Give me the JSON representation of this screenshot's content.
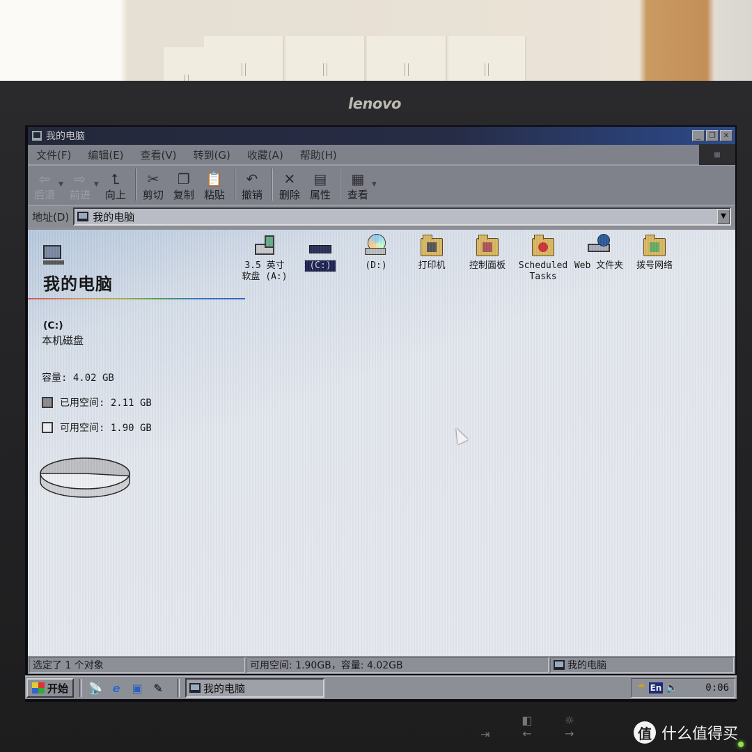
{
  "monitor": {
    "brand": "lenovo",
    "buttons": [
      "input-icon",
      "left-arrow-icon",
      "right-arrow-icon"
    ],
    "watermark": "什么值得买",
    "watermark_badge": "值"
  },
  "window": {
    "title": "我的电脑",
    "controls": {
      "minimize": "_",
      "restore": "❐",
      "close": "✕"
    }
  },
  "menu": [
    {
      "label": "文件(F)"
    },
    {
      "label": "编辑(E)"
    },
    {
      "label": "查看(V)"
    },
    {
      "label": "转到(G)"
    },
    {
      "label": "收藏(A)"
    },
    {
      "label": "帮助(H)"
    }
  ],
  "toolbar": {
    "back": "后退",
    "forward": "前进",
    "up": "向上",
    "cut": "剪切",
    "copy": "复制",
    "paste": "粘贴",
    "undo": "撤销",
    "delete": "删除",
    "properties": "属性",
    "views": "查看"
  },
  "address": {
    "label": "地址(D)",
    "value": "我的电脑"
  },
  "left_pane": {
    "title": "我的电脑",
    "drive": "(C:)",
    "drive_type": "本机磁盘",
    "capacity": "容量: 4.02 GB",
    "used": "已用空间: 2.11 GB",
    "free": "可用空间: 1.90 GB",
    "used_fraction": 0.525,
    "colors": {
      "used": "#8a8a8e",
      "free": "#eceef2"
    }
  },
  "icons": [
    {
      "label": "3.5 英寸\n软盘 (A:)",
      "icon": "floppy-drive-icon",
      "selected": false
    },
    {
      "label": "(C:)",
      "icon": "hard-drive-icon",
      "selected": true
    },
    {
      "label": "(D:)",
      "icon": "cd-drive-icon",
      "selected": false
    },
    {
      "label": "打印机",
      "icon": "printers-folder-icon",
      "selected": false
    },
    {
      "label": "控制面板",
      "icon": "control-panel-folder-icon",
      "selected": false
    },
    {
      "label": "Scheduled Tasks",
      "icon": "scheduled-tasks-folder-icon",
      "selected": false
    },
    {
      "label": "Web 文件夹",
      "icon": "web-folders-icon",
      "selected": false
    },
    {
      "label": "拨号网络",
      "icon": "dialup-networking-folder-icon",
      "selected": false
    }
  ],
  "statusbar": {
    "selection": "选定了 1 个对象",
    "space": "可用空间: 1.90GB，容量: 4.02GB",
    "location": "我的电脑"
  },
  "taskbar": {
    "start": "开始",
    "quicklaunch": [
      "channel-icon",
      "ie-icon",
      "show-desktop-icon",
      "outlook-icon"
    ],
    "tasks": [
      {
        "label": "我的电脑"
      }
    ],
    "tray": {
      "ime": "En",
      "clock": "0:06"
    }
  }
}
